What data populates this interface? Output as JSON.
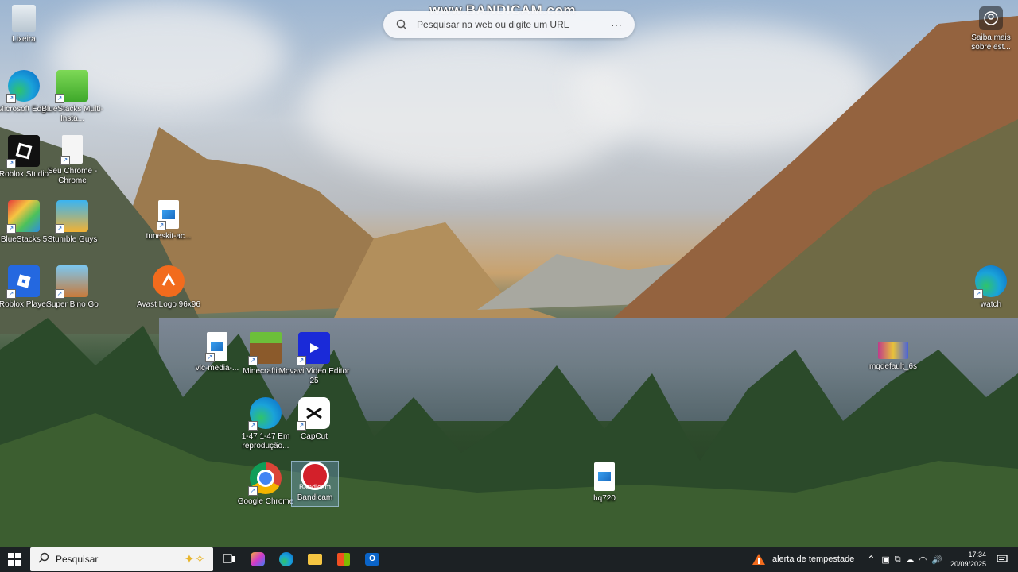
{
  "watermark": "www.BANDICAM.com",
  "browser_search": {
    "placeholder": "Pesquisar na web ou digite um URL",
    "more": "···"
  },
  "saiba_mais": {
    "label": "Saiba mais sobre est..."
  },
  "desktop_icons": {
    "lixeira": "Lixeira",
    "edge": "Microsoft Edge",
    "bluestacks_multi": "BlueStacks Multi-Insta...",
    "roblox_studio": "Roblox Studio",
    "seu_chrome": "Seu Chrome - Chrome",
    "bluestacks5": "BlueStacks 5",
    "stumble": "Stumble Guys",
    "tuneskit": "tuneskit-ac...",
    "roblox_player": "Roblox Player",
    "super_bino": "Super Bino Go",
    "avast": "Avast Logo 96x96",
    "vlc_media": "vlc-media-...",
    "minecraft": "Minecraftin...",
    "movavi": "Movavi Video Editor 25",
    "edge2": "1-47 1-47 Em reprodução...",
    "capcut": "CapCut",
    "chrome": "Google Chrome",
    "bandicam": "Bandicam",
    "bandicam_overlay": "Bandicam",
    "hq720": "hq720",
    "watch": "watch",
    "mqdefault": "mqdefault_6s"
  },
  "taskbar": {
    "search_placeholder": "Pesquisar",
    "weather": "alerta de tempestade",
    "time": "17:34",
    "date": "20/09/2025"
  },
  "colors": {
    "taskbar": "#1c2124",
    "accent": "#0a64c8"
  }
}
